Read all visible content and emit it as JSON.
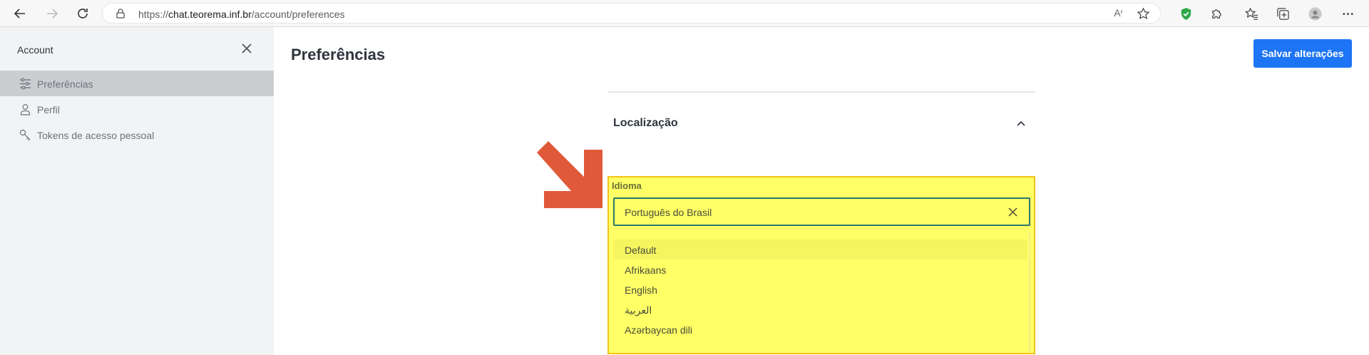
{
  "browser": {
    "url_prefix": "https://",
    "url_host": "chat.teorema.inf.br",
    "url_path": "/account/preferences",
    "read_aloud_label": "Aʳ"
  },
  "sidebar": {
    "title": "Account",
    "items": [
      {
        "label": "Preferências",
        "active": true
      },
      {
        "label": "Perfil",
        "active": false
      },
      {
        "label": "Tokens de acesso pessoal",
        "active": false
      }
    ]
  },
  "main": {
    "page_title": "Preferências",
    "save_label": "Salvar alterações",
    "section_title": "Localização",
    "language": {
      "label": "Idioma",
      "value": "Português do Brasil",
      "options": [
        "Default",
        "Afrikaans",
        "English",
        "العربية",
        "Azərbaycan dili"
      ]
    }
  },
  "colors": {
    "accent": "#1d74f5",
    "highlight": "#ffff66",
    "highlight_border": "#f0c419",
    "arrow": "#e05a3a"
  }
}
